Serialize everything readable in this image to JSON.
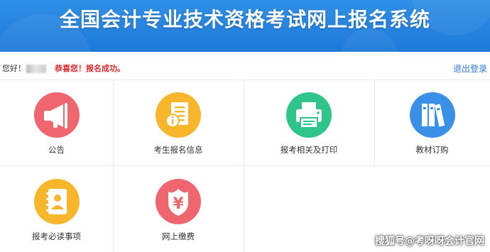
{
  "header": {
    "title": "全国会计专业技术资格考试网上报名系统"
  },
  "welcome": {
    "greeting": "您好！",
    "message": "恭喜您！报名成功。",
    "logout_label": "退出登录"
  },
  "tiles": [
    {
      "label": "公告",
      "icon": "megaphone-icon",
      "color": "#f0666f"
    },
    {
      "label": "考生报名信息",
      "icon": "document-info-icon",
      "color": "#f7b62b"
    },
    {
      "label": "报考相关及打印",
      "icon": "printer-icon",
      "color": "#2fc48a"
    },
    {
      "label": "教材订购",
      "icon": "books-icon",
      "color": "#3a8fe6"
    },
    {
      "label": "报考必读事项",
      "icon": "contact-book-icon",
      "color": "#f7b62b"
    },
    {
      "label": "网上缴费",
      "icon": "yuan-shield-icon",
      "color": "#f0666f"
    }
  ],
  "watermark": {
    "text": "搜狐号@考呀呀会计官网"
  }
}
